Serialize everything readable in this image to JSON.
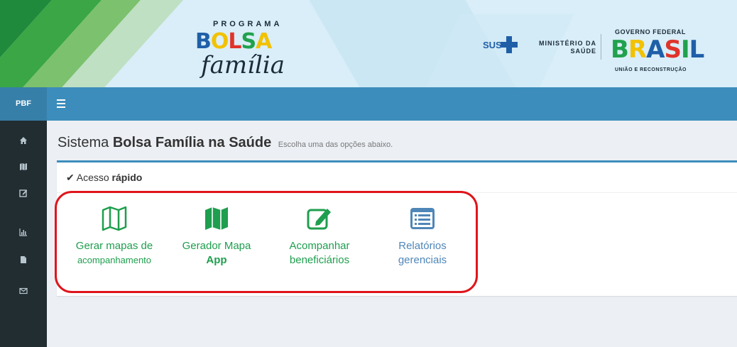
{
  "banner": {
    "program_label": "PROGRAMA",
    "bolsa_word": "BOLSA",
    "familia_word": "família",
    "sus_label": "SUS",
    "ministry_line1": "MINISTÉRIO DA",
    "ministry_line2": "SAÚDE",
    "gov_top": "GOVERNO FEDERAL",
    "gov_brasil": "BRASIL",
    "gov_bottom": "UNIÃO E RECONSTRUÇÃO"
  },
  "topbar": {
    "brand": "PBF",
    "menu_icon": "hamburger-icon"
  },
  "sidebar": {
    "items": [
      {
        "icon": "home-icon"
      },
      {
        "icon": "map-icon"
      },
      {
        "icon": "edit-icon"
      },
      {
        "icon": "bar-chart-icon"
      },
      {
        "icon": "file-icon"
      },
      {
        "icon": "envelope-icon"
      }
    ]
  },
  "page": {
    "title_prefix": "Sistema",
    "title_strong": "Bolsa Família na Saúde",
    "subtitle": "Escolha uma das opções abaixo."
  },
  "quick_access": {
    "title_prefix": "Acesso",
    "title_strong": "rápido",
    "tiles": [
      {
        "icon": "map-outline-icon",
        "line1": "Gerar mapas de",
        "line2": "acompanhamento",
        "color": "#1e9e4e"
      },
      {
        "icon": "map-filled-icon",
        "line1": "Gerador Mapa",
        "line2": "App",
        "color": "#1e9e4e"
      },
      {
        "icon": "edit-square-icon",
        "line1": "Acompanhar",
        "line2": "beneficiários",
        "color": "#1e9e4e"
      },
      {
        "icon": "list-alt-icon",
        "line1": "Relatórios",
        "line2": "gerenciais",
        "color": "#4f86b8"
      }
    ]
  },
  "colors": {
    "topbar": "#3c8dbc",
    "sidebar": "#222d32",
    "highlight": "#e0151b"
  }
}
